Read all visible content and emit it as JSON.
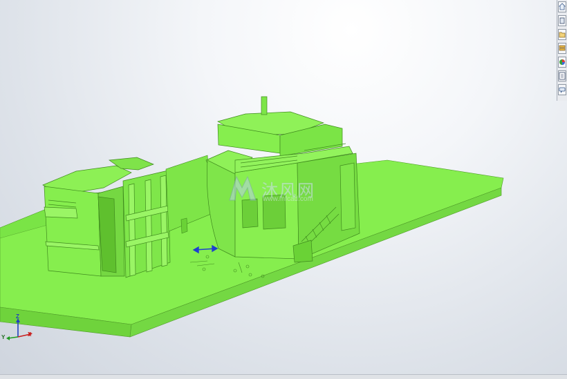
{
  "viewport": {
    "model_color": "#88f050",
    "background_top": "#ffffff",
    "background_bottom": "#cfd5de"
  },
  "triad": {
    "z_label": "Z",
    "y_label": "Y",
    "x_label": "X",
    "z_color": "#1f3fbf",
    "x_color": "#c81e1e",
    "y_color": "#1e9a1e"
  },
  "watermark": {
    "brand": "沐风网",
    "url": "www.mfcad.com"
  },
  "task_pane": {
    "buttons": [
      {
        "icon": "home-icon"
      },
      {
        "icon": "parts-library-icon"
      },
      {
        "icon": "file-explorer-icon"
      },
      {
        "icon": "search-icon"
      },
      {
        "icon": "appearances-icon"
      },
      {
        "icon": "custom-properties-icon"
      },
      {
        "icon": "forum-icon"
      }
    ]
  }
}
